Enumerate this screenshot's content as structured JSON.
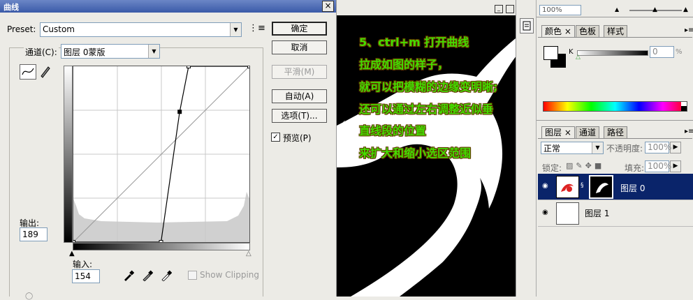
{
  "dialog": {
    "title": "曲线",
    "close_glyph": "×",
    "preset_label": "Preset:",
    "preset_value": "Custom",
    "channel_label": "通道(C):",
    "channel_value": "图层 0蒙版",
    "output_label": "输出:",
    "output_value": "189",
    "input_label": "输入:",
    "input_value": "154",
    "buttons": {
      "ok": "确定",
      "cancel": "取消",
      "smooth": "平滑(M)",
      "auto": "自动(A)",
      "options": "选项(T)..."
    },
    "preview_label": "预览(P)",
    "preview_checked": true,
    "show_clipping_label": "Show Clipping",
    "curve_points": [
      [
        0,
        0
      ],
      [
        127,
        0
      ],
      [
        154,
        189
      ],
      [
        167,
        255
      ],
      [
        255,
        255
      ]
    ]
  },
  "tutorial": {
    "lines": [
      "5、ctrl+m 打开曲线",
      "拉成如图的样子，",
      "就可以把模糊的边缘变明晰;",
      "还可以通过左右调整近似垂",
      "直线段的位置",
      "来扩大和缩小选区范围"
    ],
    "color": "#44dd00"
  },
  "top_panel": {
    "zoom": "100%"
  },
  "color_panel": {
    "tabs": [
      "颜色",
      "色板",
      "样式"
    ],
    "channel_label": "K",
    "value": "0",
    "unit": "%"
  },
  "layers_panel": {
    "tabs": [
      "图层",
      "通道",
      "路径"
    ],
    "blend_mode": "正常",
    "opacity_label": "不透明度:",
    "opacity_value": "100%",
    "lock_label": "锁定:",
    "fill_label": "填充:",
    "fill_value": "100%",
    "layers": [
      {
        "name": "图层 0",
        "selected": true
      },
      {
        "name": "图层 1",
        "selected": false
      }
    ]
  },
  "accent_color": "#0a246a"
}
